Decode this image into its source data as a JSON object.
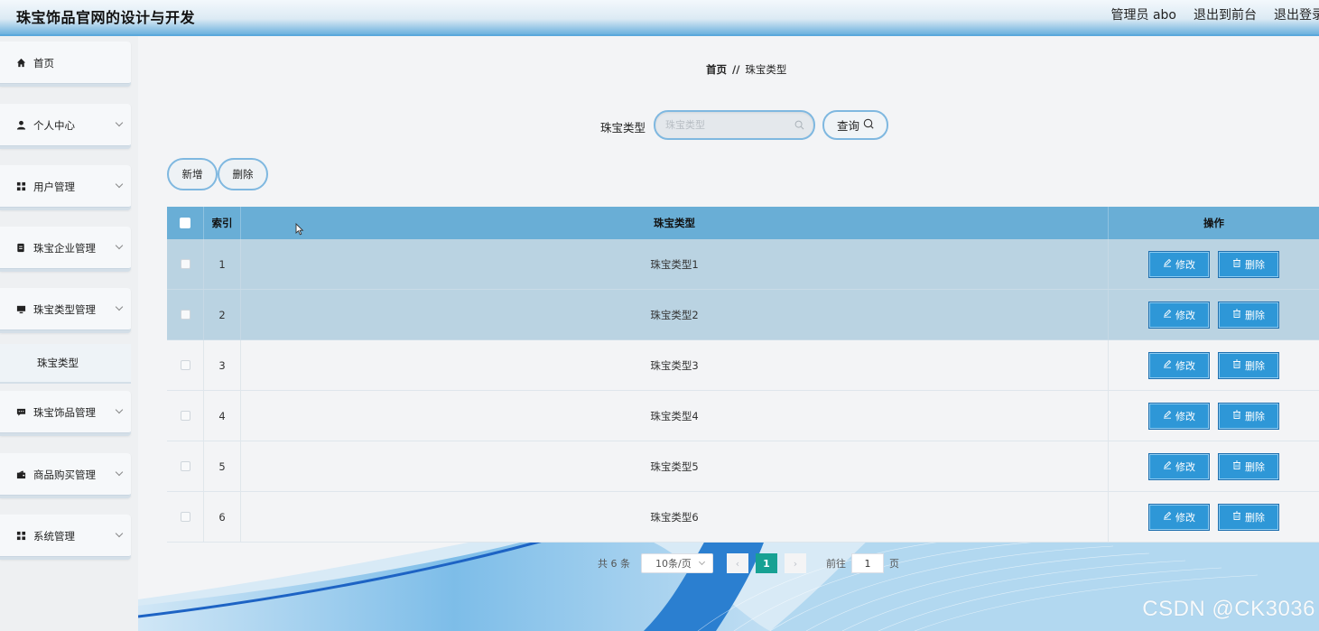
{
  "header": {
    "title": "珠宝饰品官网的设计与开发",
    "admin_label": "管理员 abo",
    "exit_front": "退出到前台",
    "logout": "退出登录"
  },
  "sidebar": {
    "items": [
      {
        "label": "首页",
        "icon": "home-icon"
      },
      {
        "label": "个人中心",
        "icon": "user-icon"
      },
      {
        "label": "用户管理",
        "icon": "grid-icon"
      },
      {
        "label": "珠宝企业管理",
        "icon": "document-icon"
      },
      {
        "label": "珠宝类型管理",
        "icon": "monitor-icon"
      },
      {
        "label": "珠宝饰品管理",
        "icon": "chat-icon"
      },
      {
        "label": "商品购买管理",
        "icon": "wallet-icon"
      },
      {
        "label": "系统管理",
        "icon": "grid-icon"
      }
    ],
    "sub_item": "珠宝类型"
  },
  "breadcrumb": {
    "home": "首页",
    "separator": "//",
    "current": "珠宝类型"
  },
  "search": {
    "label": "珠宝类型",
    "placeholder": "珠宝类型",
    "button": "查询"
  },
  "toolbar": {
    "add": "新增",
    "delete": "删除"
  },
  "table": {
    "headers": {
      "index": "索引",
      "type": "珠宝类型",
      "ops": "操作"
    },
    "rows": [
      {
        "index": "1",
        "type": "珠宝类型1"
      },
      {
        "index": "2",
        "type": "珠宝类型2"
      },
      {
        "index": "3",
        "type": "珠宝类型3"
      },
      {
        "index": "4",
        "type": "珠宝类型4"
      },
      {
        "index": "5",
        "type": "珠宝类型5"
      },
      {
        "index": "6",
        "type": "珠宝类型6"
      }
    ],
    "edit_label": "修改",
    "delete_label": "删除"
  },
  "pager": {
    "total": "共 6 条",
    "page_size": "10条/页",
    "current": "1",
    "goto": "前往",
    "goto_value": "1",
    "page_unit": "页"
  },
  "watermark": "CSDN @CK3036",
  "colors": {
    "accent": "#2e97d7",
    "table_header": "#69aed6",
    "page_current": "#17a193"
  }
}
